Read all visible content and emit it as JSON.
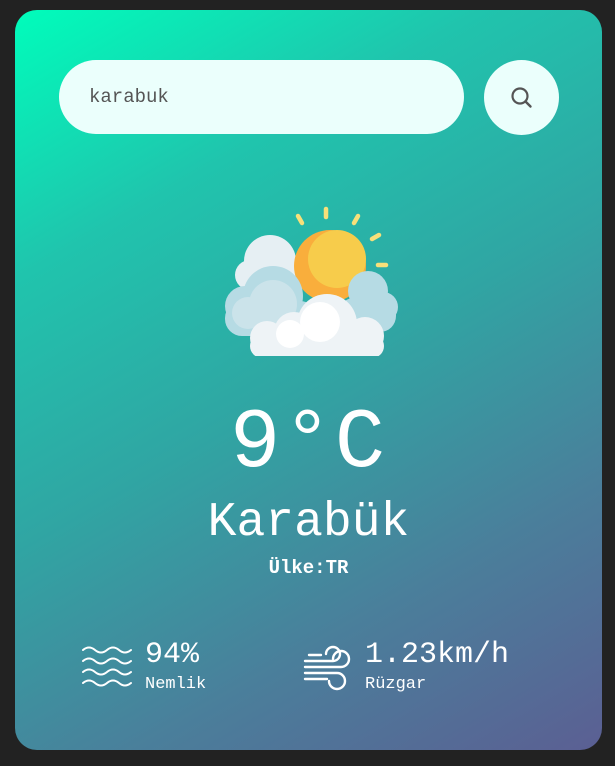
{
  "search": {
    "value": "karabuk",
    "button_icon": "search-icon"
  },
  "weather": {
    "icon": "partly-cloudy-sun-icon",
    "temperature": "9°C",
    "city": "Karabük",
    "country": "Ülke:TR"
  },
  "details": {
    "humidity": {
      "icon": "humidity-waves-icon",
      "value": "94%",
      "label": "Nemlik"
    },
    "wind": {
      "icon": "wind-icon",
      "value": "1.23km/h",
      "label": "Rüzgar"
    }
  },
  "colors": {
    "gradient_start": "#00fdbb",
    "gradient_end": "#5b5f93",
    "input_bg": "#ebfffc",
    "text": "#ffffff",
    "page_bg": "#222222"
  }
}
